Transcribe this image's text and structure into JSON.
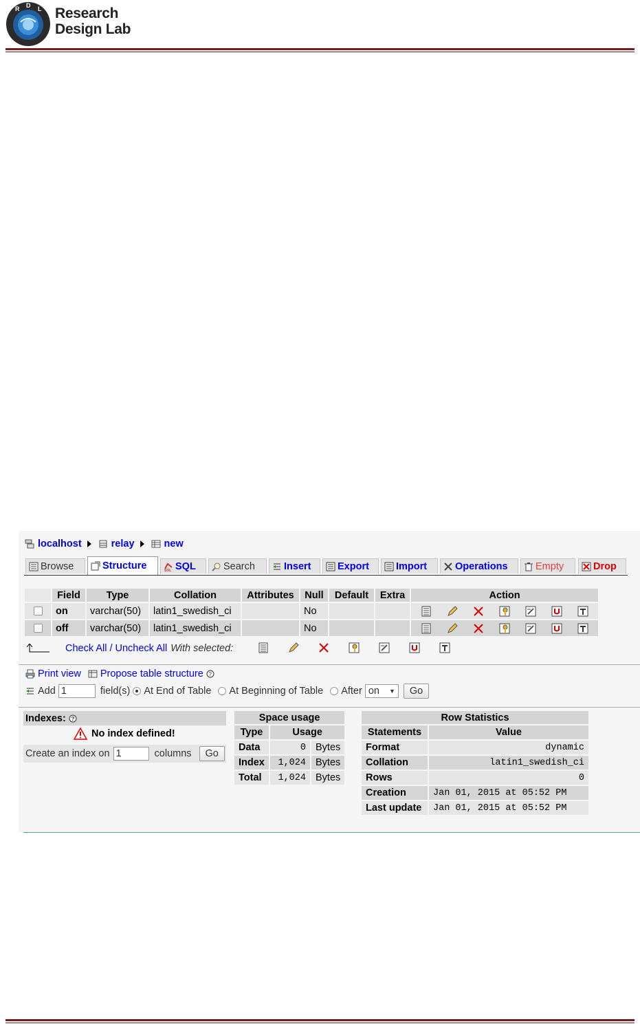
{
  "brand": {
    "line1": "Research",
    "line2": "Design Lab",
    "badge_letters": [
      "R",
      "D",
      "L"
    ]
  },
  "breadcrumb": {
    "server": "localhost",
    "database": "relay",
    "table": "new"
  },
  "tabs": [
    {
      "label": "Browse",
      "icon": "browse-icon"
    },
    {
      "label": "Structure",
      "icon": "structure-icon"
    },
    {
      "label": "SQL",
      "icon": "sql-icon"
    },
    {
      "label": "Search",
      "icon": "search-icon"
    },
    {
      "label": "Insert",
      "icon": "insert-icon"
    },
    {
      "label": "Export",
      "icon": "export-icon"
    },
    {
      "label": "Import",
      "icon": "import-icon"
    },
    {
      "label": "Operations",
      "icon": "operations-icon"
    },
    {
      "label": "Empty",
      "icon": "empty-icon"
    },
    {
      "label": "Drop",
      "icon": "drop-icon"
    }
  ],
  "structure": {
    "columns": [
      "Field",
      "Type",
      "Collation",
      "Attributes",
      "Null",
      "Default",
      "Extra",
      "Action"
    ],
    "rows": [
      {
        "field": "on",
        "type": "varchar(50)",
        "collation": "latin1_swedish_ci",
        "attributes": "",
        "null": "No",
        "default": "",
        "extra": ""
      },
      {
        "field": "off",
        "type": "varchar(50)",
        "collation": "latin1_swedish_ci",
        "attributes": "",
        "null": "No",
        "default": "",
        "extra": ""
      }
    ],
    "action_icons": [
      "browse-distinct-icon",
      "edit-pencil-icon",
      "delete-x-icon",
      "primary-key-icon",
      "index-icon",
      "unique-icon",
      "fulltext-icon"
    ]
  },
  "with_selected": {
    "check_all": "Check All",
    "divider": "/",
    "uncheck_all": "Uncheck All",
    "label": "With selected:"
  },
  "tools": {
    "print_view": "Print view",
    "propose": "Propose table structure"
  },
  "add_fields": {
    "add_label": "Add",
    "count": "1",
    "fields_label": "field(s)",
    "end_label": "At End of Table",
    "begin_label": "At Beginning of Table",
    "after_label": "After",
    "after_value": "on",
    "go": "Go"
  },
  "indexes": {
    "heading": "Indexes:",
    "warning": "No index defined!",
    "create_label": "Create an index on",
    "create_count": "1",
    "columns_label": "columns",
    "go": "Go"
  },
  "space_usage": {
    "heading": "Space usage",
    "col_type": "Type",
    "col_usage": "Usage",
    "rows": [
      {
        "type": "Data",
        "value": "0",
        "unit": "Bytes"
      },
      {
        "type": "Index",
        "value": "1,024",
        "unit": "Bytes"
      },
      {
        "type": "Total",
        "value": "1,024",
        "unit": "Bytes"
      }
    ]
  },
  "row_stats": {
    "heading": "Row Statistics",
    "col_statements": "Statements",
    "col_value": "Value",
    "rows": [
      {
        "label": "Format",
        "value": "dynamic"
      },
      {
        "label": "Collation",
        "value": "latin1_swedish_ci"
      },
      {
        "label": "Rows",
        "value": "0"
      },
      {
        "label": "Creation",
        "value": "Jan 01, 2015 at 05:52 PM"
      },
      {
        "label": "Last update",
        "value": "Jan 01, 2015 at 05:52 PM"
      }
    ]
  }
}
